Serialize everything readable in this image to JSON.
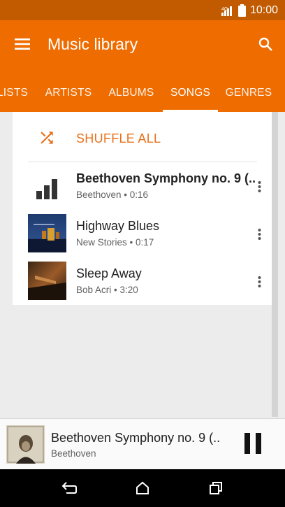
{
  "status_bar": {
    "time": "10:00"
  },
  "app_bar": {
    "title": "Music library"
  },
  "tabs": [
    {
      "label": "LISTS"
    },
    {
      "label": "ARTISTS"
    },
    {
      "label": "ALBUMS"
    },
    {
      "label": "SONGS",
      "active": true
    },
    {
      "label": "GENRES"
    }
  ],
  "shuffle": {
    "label": "SHUFFLE ALL"
  },
  "songs": [
    {
      "title": "Beethoven Symphony no. 9 (..",
      "artist": "Beethoven",
      "duration": "0:16",
      "subtitle": "Beethoven • 0:16",
      "playing": true
    },
    {
      "title": "Highway Blues",
      "artist": "New Stories",
      "duration": "0:17",
      "subtitle": "New Stories • 0:17"
    },
    {
      "title": "Sleep Away",
      "artist": "Bob Acri",
      "duration": "3:20",
      "subtitle": "Bob Acri • 3:20"
    }
  ],
  "now_playing": {
    "title": "Beethoven Symphony no. 9 (..",
    "artist": "Beethoven"
  },
  "colors": {
    "accent": "#ef6c00",
    "status": "#c25a00",
    "accent_text": "#e8711c"
  },
  "icons": {
    "menu": "menu-icon",
    "search": "search-icon",
    "shuffle": "shuffle-icon",
    "equalizer": "equalizer-icon",
    "more": "more-vert-icon",
    "pause": "pause-icon",
    "back": "back-icon",
    "home": "home-icon",
    "recents": "recents-icon"
  }
}
